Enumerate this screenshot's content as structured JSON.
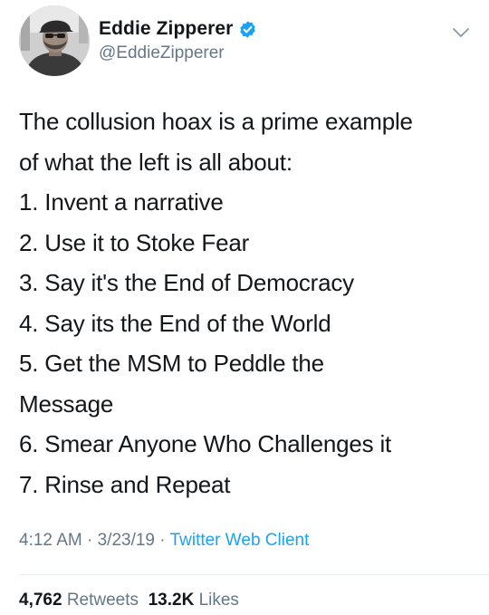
{
  "author": {
    "display_name": "Eddie Zipperer",
    "handle": "@EddieZipperer",
    "verified": true
  },
  "tweet": {
    "lines": [
      "The collusion hoax is a prime example",
      "of what the left is all about:",
      "1. Invent a narrative",
      "2. Use it to Stoke Fear",
      "3. Say it's the End of Democracy",
      "4. Say its the End of the World",
      "5. Get the MSM to Peddle the",
      "Message",
      "6. Smear Anyone Who Challenges it",
      "7. Rinse and Repeat"
    ]
  },
  "meta": {
    "time": "4:12 AM",
    "separator": "·",
    "date": "3/23/19",
    "source": "Twitter Web Client"
  },
  "stats": {
    "retweets_count": "4,762",
    "retweets_label": "Retweets",
    "likes_count": "13.2K",
    "likes_label": "Likes"
  },
  "colors": {
    "text": "#14171a",
    "secondary": "#657786",
    "link": "#1da1f2",
    "verified": "#1da1f2",
    "divider": "#e6ecf0"
  },
  "icons": {
    "verified": "verified-badge-icon",
    "menu": "chevron-down-icon"
  }
}
